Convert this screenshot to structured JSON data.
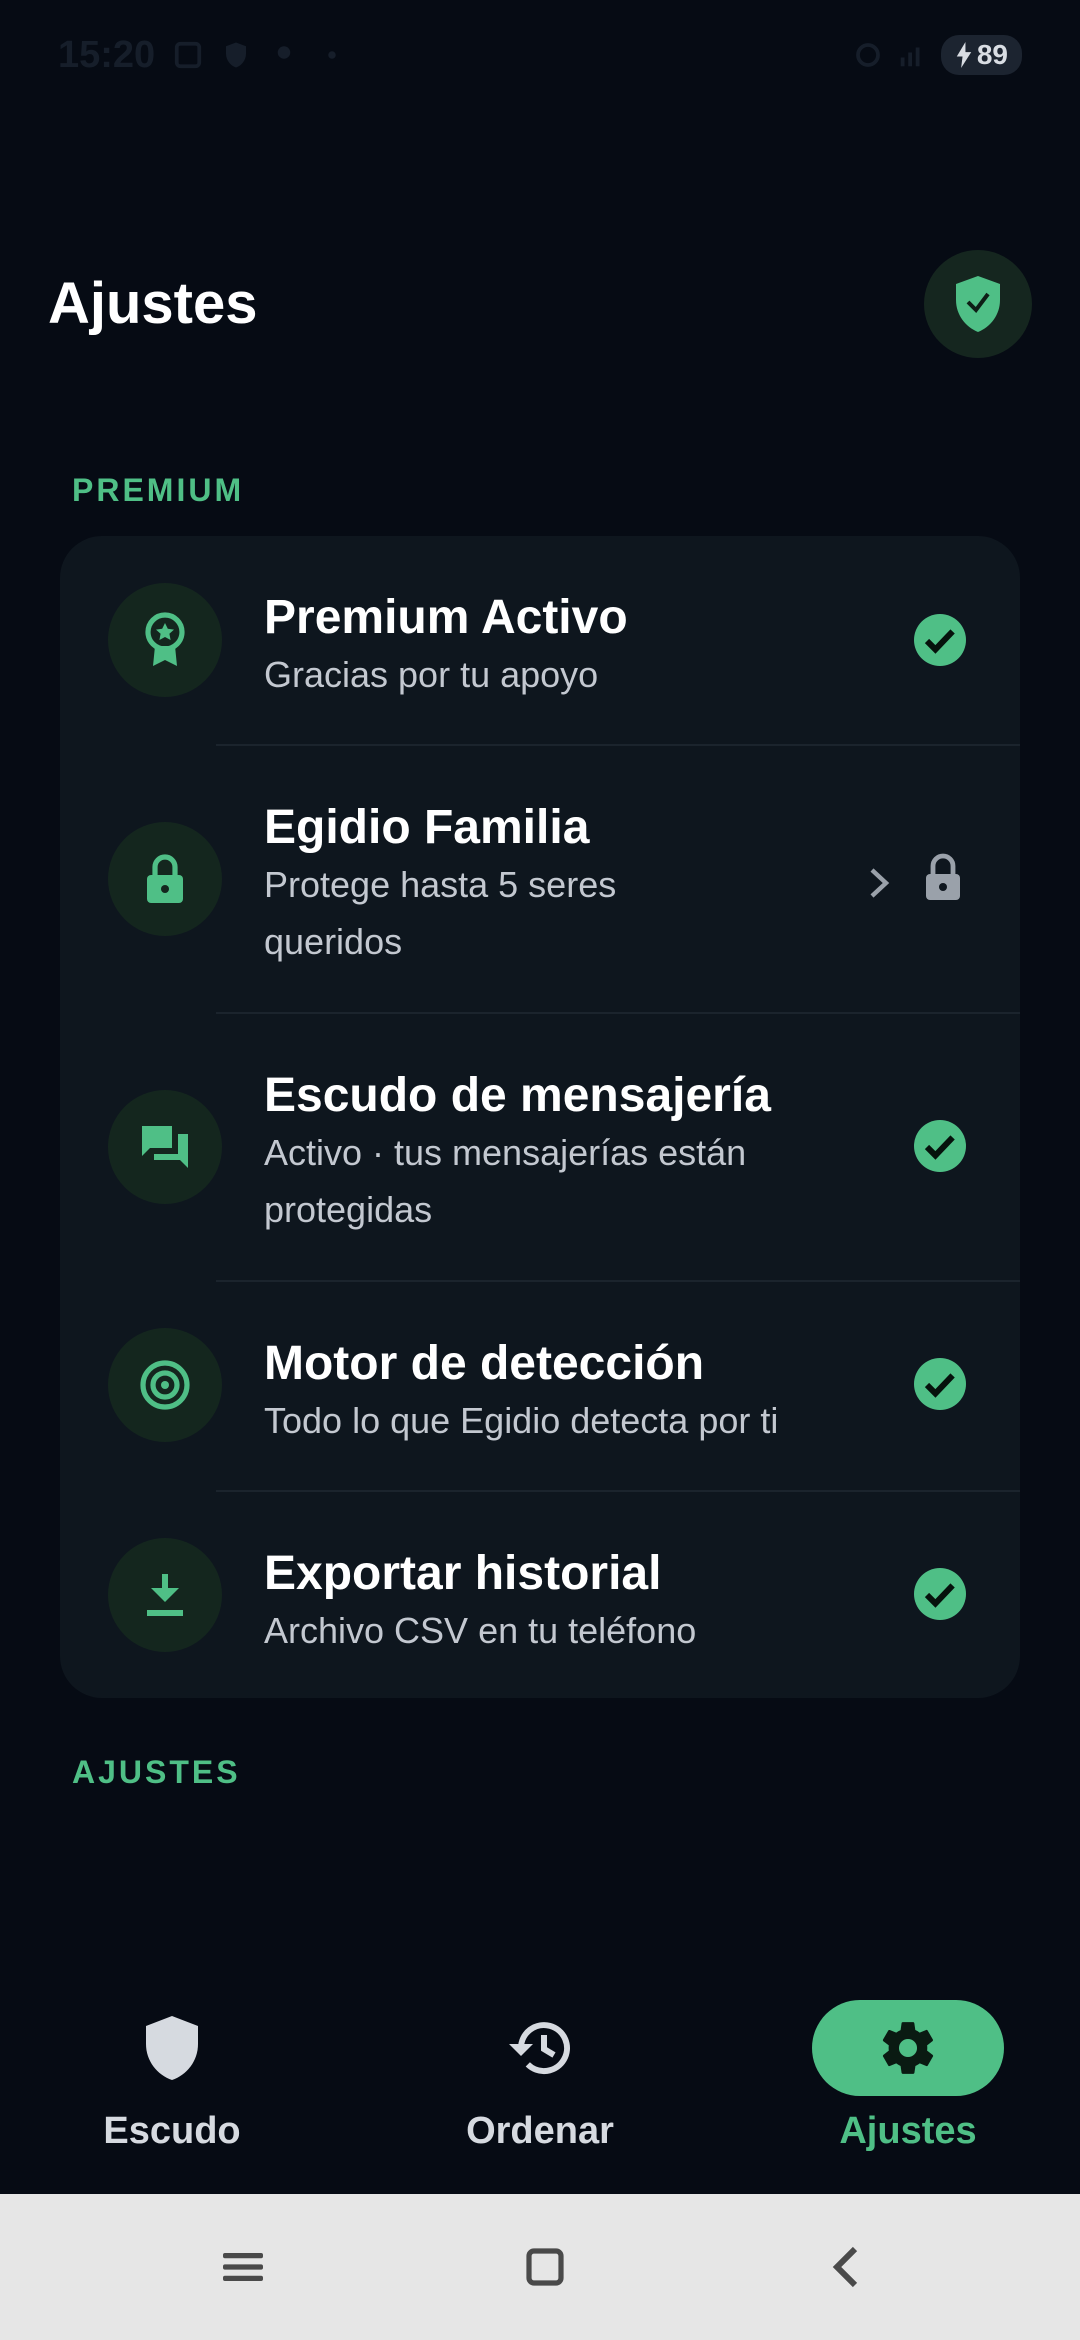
{
  "status_bar": {
    "time": "15:20",
    "battery": "89"
  },
  "header": {
    "title": "Ajustes"
  },
  "sections": {
    "premium_label": "PREMIUM",
    "settings_label": "AJUSTES"
  },
  "premium_items": [
    {
      "title": "Premium Activo",
      "subtitle": "Gracias por tu apoyo",
      "icon": "award-icon",
      "status": "check-icon"
    },
    {
      "title": "Egidio Familia",
      "subtitle": "Protege hasta 5 seres queridos",
      "icon": "lock-icon",
      "status": "lock-icon"
    },
    {
      "title": "Escudo de mensajería",
      "subtitle": "Activo · tus mensajerías están protegidas",
      "icon": "chat-icon",
      "status": "check-icon"
    },
    {
      "title": "Motor de detección",
      "subtitle": "Todo lo que Egidio detecta por ti",
      "icon": "target-icon",
      "status": "check-icon"
    },
    {
      "title": "Exportar historial",
      "subtitle": "Archivo CSV en tu teléfono",
      "icon": "download-icon",
      "status": "check-icon"
    }
  ],
  "bottom_nav": [
    {
      "label": "Escudo",
      "icon": "shield-icon",
      "active": false
    },
    {
      "label": "Ordenar",
      "icon": "history-icon",
      "active": false
    },
    {
      "label": "Ajustes",
      "icon": "gear-icon",
      "active": true
    }
  ],
  "colors": {
    "background": "#060b14",
    "card": "#0e161e",
    "accent": "#4fbf86",
    "icon_circle": "#14261e"
  }
}
